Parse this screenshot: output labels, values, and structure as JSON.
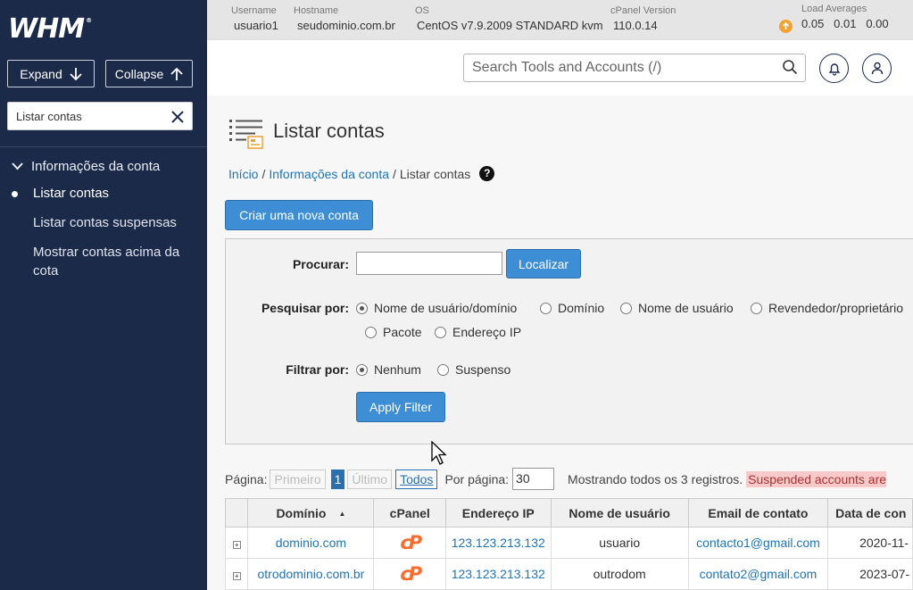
{
  "sidebar": {
    "logo": "WHM",
    "logo_mark": "®",
    "expand_label": "Expand",
    "collapse_label": "Collapse",
    "search_value": "Listar contas",
    "group_label": "Informações da conta",
    "items": [
      {
        "label": "Listar contas",
        "active": true
      },
      {
        "label": "Listar contas suspensas",
        "active": false
      },
      {
        "label": "Mostrar contas acima da cota",
        "active": false
      }
    ]
  },
  "infobar": {
    "username_label": "Username",
    "username": "usuario1",
    "hostname_label": "Hostname",
    "hostname": "seudominio.com.br",
    "os_label": "OS",
    "os": "CentOS v7.9.2009 STANDARD kvm",
    "cpanel_version_label": "cPanel Version",
    "cpanel_version": "110.0.14",
    "load_label": "Load Averages",
    "load": [
      "0.05",
      "0.01",
      "0.00"
    ]
  },
  "header": {
    "search_placeholder": "Search Tools and Accounts (/)"
  },
  "page": {
    "title": "Listar contas",
    "breadcrumb": [
      "Início",
      "Informações da conta",
      "Listar contas"
    ],
    "breadcrumb_sep": "/",
    "help_glyph": "?",
    "create_button": "Criar uma nova conta"
  },
  "filter": {
    "search_label": "Procurar:",
    "search_value": "",
    "locate_button": "Localizar",
    "search_by_label": "Pesquisar por:",
    "search_by_options": [
      {
        "label": "Nome de usuário/domínio",
        "checked": true
      },
      {
        "label": "Domínio",
        "checked": false
      },
      {
        "label": "Nome de usuário",
        "checked": false
      },
      {
        "label": "Revendedor/proprietário",
        "checked": false
      },
      {
        "label": "Pacote",
        "checked": false
      },
      {
        "label": "Endereço IP",
        "checked": false
      }
    ],
    "filter_by_label": "Filtrar por:",
    "filter_by_options": [
      {
        "label": "Nenhum",
        "checked": true
      },
      {
        "label": "Suspenso",
        "checked": false
      }
    ],
    "apply_button": "Apply Filter"
  },
  "pagination": {
    "page_label": "Página:",
    "first": "Primeiro",
    "current": "1",
    "last": "Último",
    "all": "Todos",
    "per_page_label": "Por página:",
    "per_page_value": "30",
    "showing_text": "Mostrando todos os 3 registros.",
    "suspended_text": "Suspended accounts are"
  },
  "table": {
    "columns": [
      "Domínio",
      "cPanel",
      "Endereço IP",
      "Nome de usuário",
      "Email de contato",
      "Data de con"
    ],
    "sort_glyph": "▲",
    "expand_glyph": "+",
    "cpanel_logo": "cP",
    "rows": [
      {
        "domain": "dominio.com",
        "ip": "123.123.213.132",
        "user": "usuario",
        "email": "contacto1@gmail.com",
        "date": "2020-11-"
      },
      {
        "domain": "otrodominio.com.br",
        "ip": "123.123.213.132",
        "user": "outrodom",
        "email": "contato2@gmail.com",
        "date": "2023-07-"
      }
    ]
  },
  "colors": {
    "sidebar_bg": "#1c2a4a",
    "accent_blue": "#3d8ed5",
    "link_blue": "#1f74b8",
    "cpanel_orange": "#ff6c2c",
    "suspended_bg": "#f7c9c9"
  },
  "icons": [
    "arrow-down-icon",
    "arrow-up-icon",
    "close-icon",
    "chevron-down-icon",
    "search-icon",
    "bell-icon",
    "user-icon",
    "list-icon",
    "help-icon",
    "upload-icon",
    "cpanel-icon",
    "expand-icon",
    "sort-asc-icon"
  ]
}
